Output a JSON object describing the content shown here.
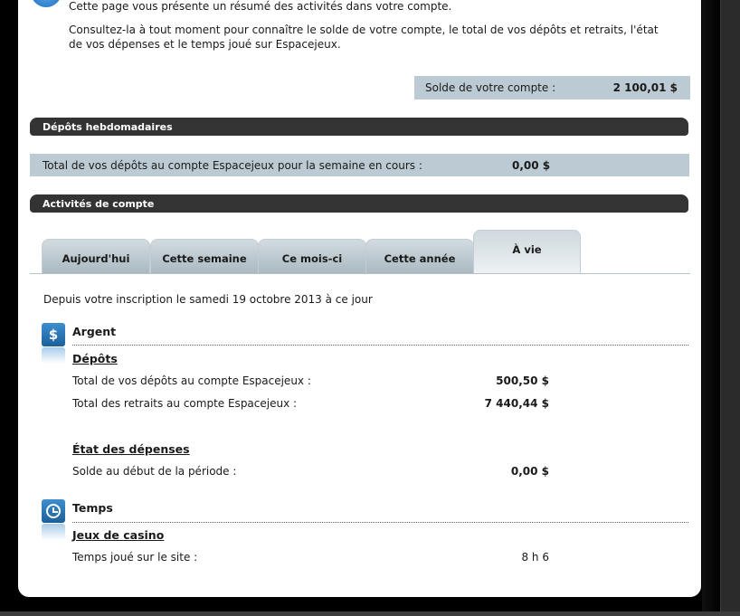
{
  "intro": {
    "line1": "Cette page vous présente un résumé des activités dans votre compte.",
    "line2": "Consultez-la à tout moment pour connaître le solde de votre compte, le total de vos dépôts et retraits, l'état de vos dépenses et le temps joué sur Espacejeux."
  },
  "balance": {
    "label": "Solde de votre compte :",
    "value": "2 100,01 $"
  },
  "weekly": {
    "title": "Dépôts hebdomadaires",
    "label": "Total de vos dépôts au compte Espacejeux pour la semaine en cours :",
    "value": "0,00 $"
  },
  "activity": {
    "title": "Activités de compte",
    "tabs": [
      {
        "label": "Aujourd'hui",
        "active": false
      },
      {
        "label": "Cette semaine",
        "active": false
      },
      {
        "label": "Ce mois-ci",
        "active": false
      },
      {
        "label": "Cette année",
        "active": false
      },
      {
        "label": "À vie",
        "active": true
      }
    ],
    "since": "Depuis votre inscription le samedi 19 octobre 2013 à ce jour"
  },
  "money": {
    "icon": "dollar-icon",
    "glyph": "$",
    "title": "Argent",
    "deposits_title": "Dépôts",
    "rows": [
      {
        "label": "Total de vos dépôts au compte Espacejeux :",
        "value": "500,50 $"
      },
      {
        "label": "Total des retraits au compte Espacejeux :",
        "value": "7 440,44 $"
      }
    ],
    "spending_title": "État des dépenses",
    "spending_rows": [
      {
        "label": "Solde au début de la période :",
        "value": "0,00 $"
      }
    ]
  },
  "time": {
    "icon": "clock-icon",
    "title": "Temps",
    "casino_title": "Jeux de casino",
    "rows": [
      {
        "label": "Temps joué sur le site :",
        "value": "8 h 6"
      }
    ]
  },
  "colors": {
    "accent_blue": "#2a78bf",
    "bar_dark": "#333333",
    "row_grey": "#bccbd3"
  }
}
